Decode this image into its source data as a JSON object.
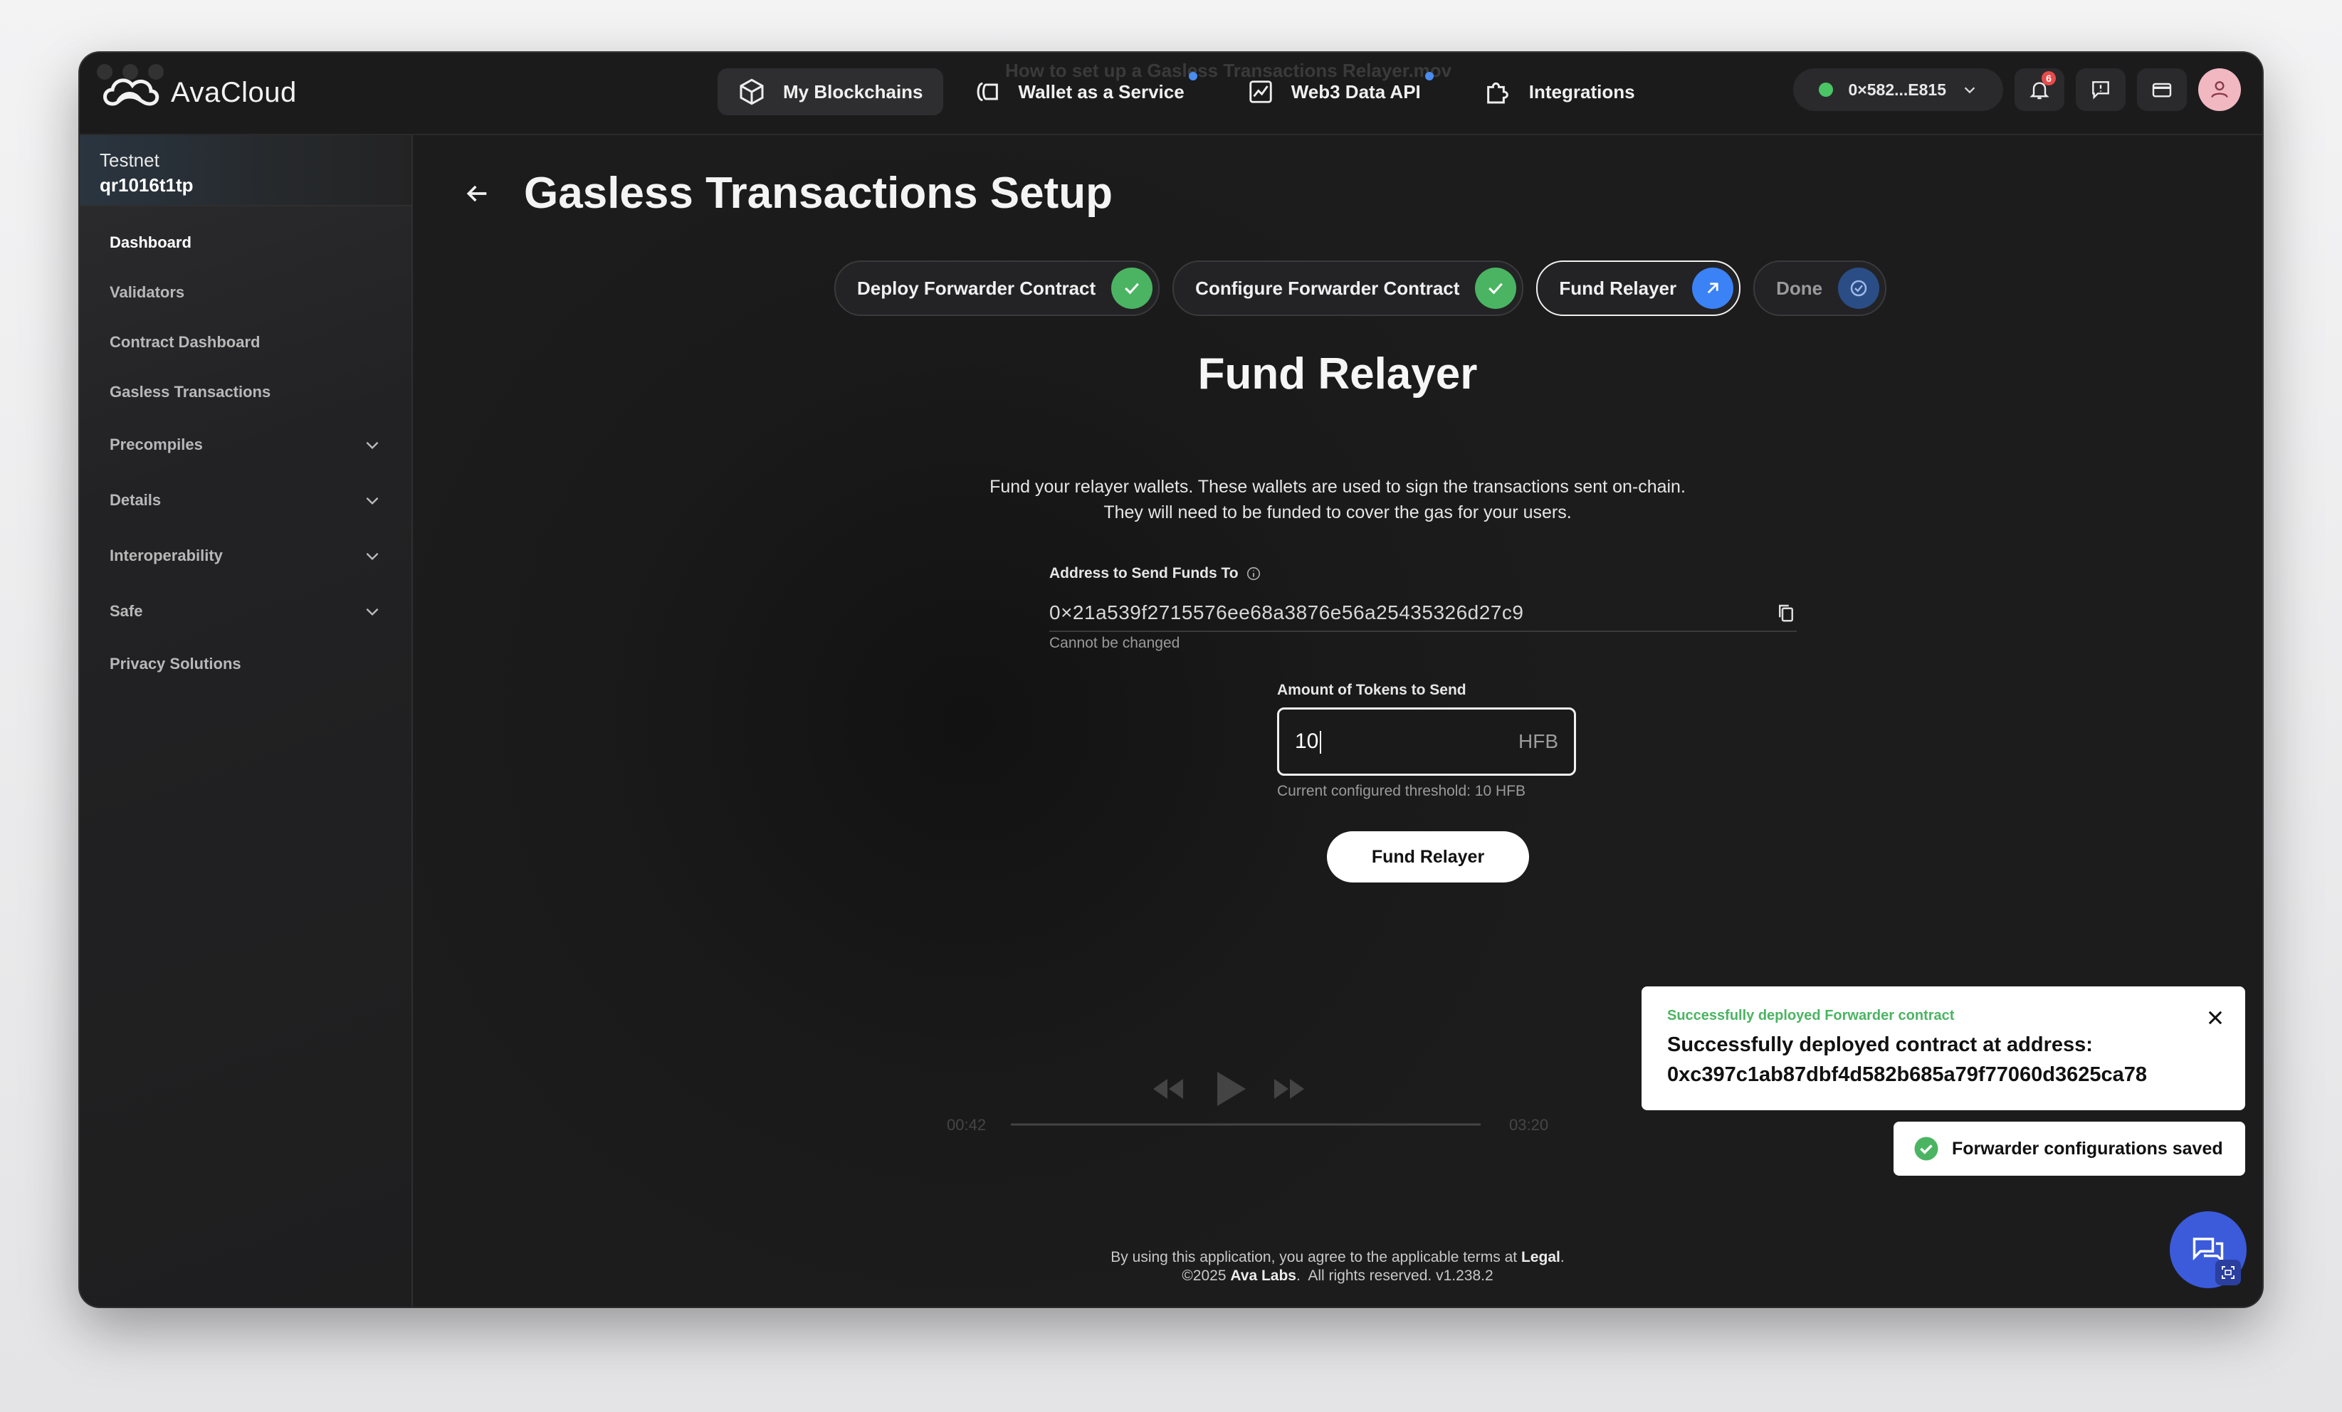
{
  "app": {
    "name": "AvaCloud"
  },
  "ghost_title": "How to set up a Gasless Transactions Relayer.mov",
  "nav": {
    "items": [
      {
        "label": "My Blockchains",
        "icon": "cube-icon"
      },
      {
        "label": "Wallet as a Service",
        "icon": "wallet-icon"
      },
      {
        "label": "Web3 Data API",
        "icon": "chart-icon"
      },
      {
        "label": "Integrations",
        "icon": "puzzle-icon"
      }
    ]
  },
  "account": {
    "wallet_address": "0×582...E815",
    "notification_count": "6"
  },
  "sidebar": {
    "network": "Testnet",
    "chain_name": "qr1016t1tp",
    "items": [
      {
        "label": "Dashboard"
      },
      {
        "label": "Validators"
      },
      {
        "label": "Contract Dashboard"
      },
      {
        "label": "Gasless Transactions"
      },
      {
        "label": "Precompiles"
      },
      {
        "label": "Details"
      },
      {
        "label": "Interoperability"
      },
      {
        "label": "Safe"
      },
      {
        "label": "Privacy Solutions"
      }
    ]
  },
  "page": {
    "title": "Gasless Transactions Setup",
    "steps": [
      {
        "label": "Deploy Forwarder Contract",
        "status": "complete"
      },
      {
        "label": "Configure Forwarder Contract",
        "status": "complete"
      },
      {
        "label": "Fund Relayer",
        "status": "current"
      },
      {
        "label": "Done",
        "status": "pending"
      }
    ],
    "section_title": "Fund Relayer",
    "description_line1": "Fund your relayer wallets. These wallets are used to sign the transactions sent on-chain.",
    "description_line2": "They will need to be funded to cover the gas for your users.",
    "address_label": "Address to Send Funds To",
    "address_value": "0×21a539f2715576ee68a3876e56a25435326d27c9",
    "address_hint": "Cannot be changed",
    "amount_label": "Amount of Tokens to Send",
    "amount_value": "10",
    "amount_unit": "HFB",
    "threshold_hint": "Current configured threshold: 10 HFB",
    "fund_button": "Fund Relayer"
  },
  "player": {
    "time_elapsed": "00:42",
    "time_total": "03:20"
  },
  "footer": {
    "line1_prefix": "By using this application, you agree to the applicable terms at",
    "legal_link": "Legal",
    "copyright_prefix": "©2025",
    "company": "Ava Labs",
    "rights": "All rights reserved.",
    "version": "v1.238.2"
  },
  "toasts": {
    "deploy_sub": "Successfully deployed Forwarder contract",
    "deploy_main_line1": "Successfully deployed contract at address:",
    "deploy_main_line2": "0xc397c1ab87dbf4d582b685a79f77060d3625ca78",
    "config_saved": "Forwarder configurations saved"
  },
  "colors": {
    "accent_blue": "#3b82f6",
    "success_green": "#4bb462",
    "background": "#1a1a1b"
  }
}
